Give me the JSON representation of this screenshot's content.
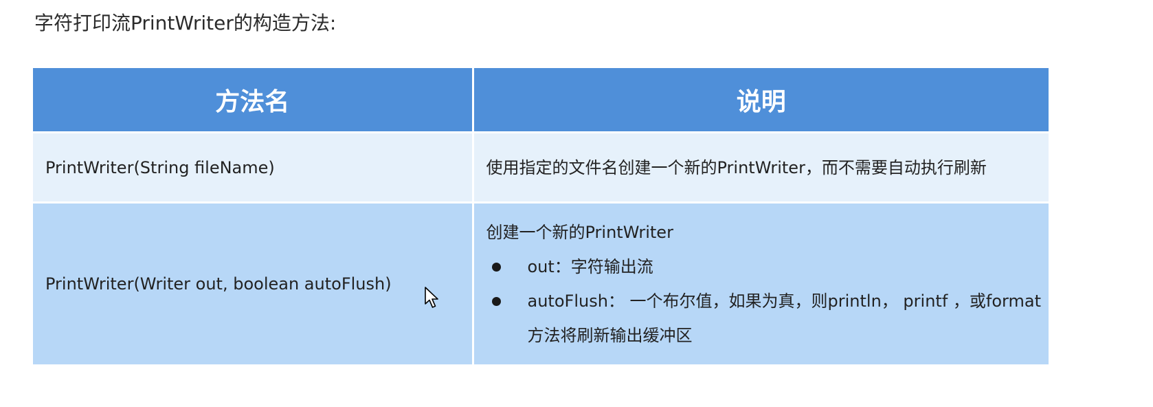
{
  "heading": "字符打印流PrintWriter的构造方法:",
  "table": {
    "headers": [
      "方法名",
      "说明"
    ],
    "rows": [
      {
        "method": "PrintWriter(String fileName)",
        "description": "使用指定的文件名创建一个新的PrintWriter，而不需要自动执行刷新"
      },
      {
        "method": "PrintWriter(Writer out, boolean autoFlush)",
        "description_intro": "创建一个新的PrintWriter",
        "bullets": [
          "out：字符输出流",
          "autoFlush： 一个布尔值，如果为真，则println， printf ，或format方法将刷新输出缓冲区"
        ]
      }
    ]
  },
  "colors": {
    "header_bg": "#4f8fd9",
    "row1_bg": "#e6f1fb",
    "row2_bg": "#b7d7f7"
  },
  "icons": {
    "cursor": "mouse-pointer-icon",
    "bullet": "bullet-dot-icon"
  }
}
